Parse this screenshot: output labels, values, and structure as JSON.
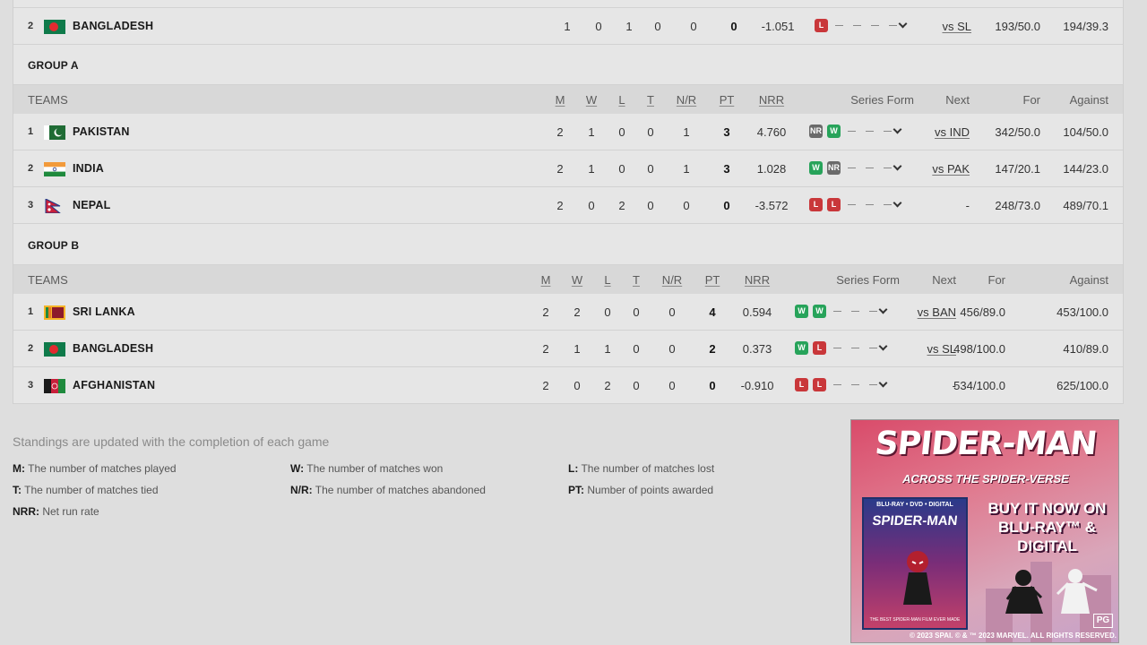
{
  "top_row": {
    "rank": "2",
    "team": "BANGLADESH",
    "flag": "bangladesh-flag",
    "m": "1",
    "w": "0",
    "l": "1",
    "t": "0",
    "nr": "0",
    "pt": "0",
    "nrr": "-1.051",
    "form": [
      "L"
    ],
    "next": "vs SL",
    "for": "193/50.0",
    "against": "194/39.3"
  },
  "headers": {
    "teams": "TEAMS",
    "m": "M",
    "w": "W",
    "l": "L",
    "t": "T",
    "nr": "N/R",
    "pt": "PT",
    "nrr": "NRR",
    "series_form": "Series Form",
    "next": "Next",
    "for": "For",
    "against": "Against"
  },
  "groups": [
    {
      "title": "GROUP A",
      "rows": [
        {
          "rank": "1",
          "team": "PAKISTAN",
          "flag": "pakistan-flag",
          "m": "2",
          "w": "1",
          "l": "0",
          "t": "0",
          "nr": "1",
          "pt": "3",
          "nrr": "4.760",
          "form": [
            "NR",
            "W"
          ],
          "next": "vs IND",
          "for": "342/50.0",
          "against": "104/50.0"
        },
        {
          "rank": "2",
          "team": "INDIA",
          "flag": "india-flag",
          "m": "2",
          "w": "1",
          "l": "0",
          "t": "0",
          "nr": "1",
          "pt": "3",
          "nrr": "1.028",
          "form": [
            "W",
            "NR"
          ],
          "next": "vs PAK",
          "for": "147/20.1",
          "against": "144/23.0"
        },
        {
          "rank": "3",
          "team": "NEPAL",
          "flag": "nepal-flag",
          "m": "2",
          "w": "0",
          "l": "2",
          "t": "0",
          "nr": "0",
          "pt": "0",
          "nrr": "-3.572",
          "form": [
            "L",
            "L"
          ],
          "next": "-",
          "for": "248/73.0",
          "against": "489/70.1"
        }
      ]
    },
    {
      "title": "GROUP B",
      "rows": [
        {
          "rank": "1",
          "team": "SRI LANKA",
          "flag": "sri-lanka-flag",
          "m": "2",
          "w": "2",
          "l": "0",
          "t": "0",
          "nr": "0",
          "pt": "4",
          "nrr": "0.594",
          "form": [
            "W",
            "W"
          ],
          "next": "vs BAN",
          "for": "456/89.0",
          "against": "453/100.0"
        },
        {
          "rank": "2",
          "team": "BANGLADESH",
          "flag": "bangladesh-flag",
          "m": "2",
          "w": "1",
          "l": "1",
          "t": "0",
          "nr": "0",
          "pt": "2",
          "nrr": "0.373",
          "form": [
            "W",
            "L"
          ],
          "next": "vs SL",
          "for": "498/100.0",
          "against": "410/89.0"
        },
        {
          "rank": "3",
          "team": "AFGHANISTAN",
          "flag": "afghanistan-flag",
          "m": "2",
          "w": "0",
          "l": "2",
          "t": "0",
          "nr": "0",
          "pt": "0",
          "nrr": "-0.910",
          "form": [
            "L",
            "L"
          ],
          "next": "-",
          "for": "534/100.0",
          "against": "625/100.0"
        }
      ]
    }
  ],
  "legend": {
    "note": "Standings are updated with the completion of each game",
    "items": [
      {
        "key": "M:",
        "text": "The number of matches played"
      },
      {
        "key": "W:",
        "text": "The number of matches won"
      },
      {
        "key": "L:",
        "text": "The number of matches lost"
      },
      {
        "key": "T:",
        "text": "The number of matches tied"
      },
      {
        "key": "N/R:",
        "text": "The number of matches abandoned"
      },
      {
        "key": "PT:",
        "text": "Number of points awarded"
      },
      {
        "key": "NRR:",
        "text": "Net run rate"
      }
    ]
  },
  "ad": {
    "title": "SPIDER-MAN",
    "subtitle": "ACROSS THE SPIDER-VERSE",
    "box_top": "BLU-RAY • DVD • DIGITAL",
    "box_title": "SPIDER-MAN",
    "box_tagline": "THE BEST SPIDER-MAN FILM EVER MADE",
    "cta": "BUY IT NOW ON BLU-RAY™ & DIGITAL",
    "copyright": "© 2023 SPAI. © & ™ 2023 MARVEL. ALL RIGHTS RESERVED.",
    "rating": "PG"
  },
  "colors": {
    "loss": "#c9373a",
    "win": "#27a35a",
    "no_result": "#6a6a6a"
  }
}
